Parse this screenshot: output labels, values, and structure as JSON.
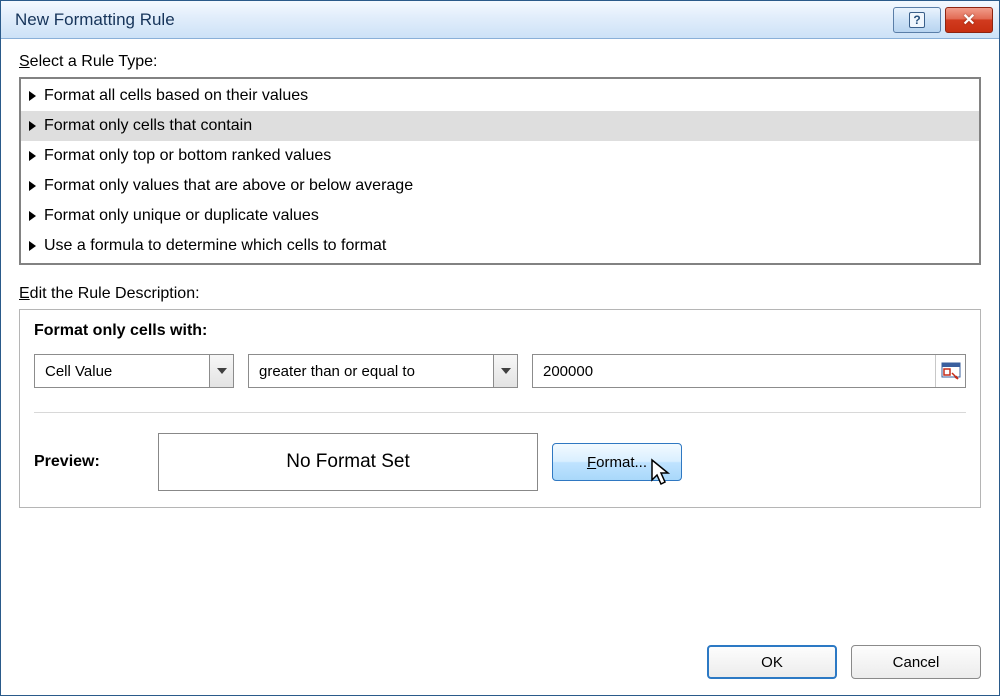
{
  "titlebar": {
    "title": "New Formatting Rule"
  },
  "sections": {
    "rule_type_label_prefix": "S",
    "rule_type_label_rest": "elect a Rule Type:",
    "edit_desc_label_prefix": "E",
    "edit_desc_label_rest": "dit the Rule Description:"
  },
  "rule_types": [
    {
      "label": "Format all cells based on their values",
      "selected": false
    },
    {
      "label": "Format only cells that contain",
      "selected": true
    },
    {
      "label": "Format only top or bottom ranked values",
      "selected": false
    },
    {
      "label": "Format only values that are above or below average",
      "selected": false
    },
    {
      "label": "Format only unique or duplicate values",
      "selected": false
    },
    {
      "label": "Use a formula to determine which cells to format",
      "selected": false
    }
  ],
  "desc": {
    "heading_prefix": "F",
    "heading_rest": "ormat only cells with:",
    "combo1": "Cell Value",
    "combo2": "greater than or equal to",
    "value": "200000",
    "preview_label": "Preview:",
    "preview_text": "No Format Set",
    "format_btn_prefix": "F",
    "format_btn_rest": "ormat..."
  },
  "footer": {
    "ok": "OK",
    "cancel": "Cancel"
  }
}
